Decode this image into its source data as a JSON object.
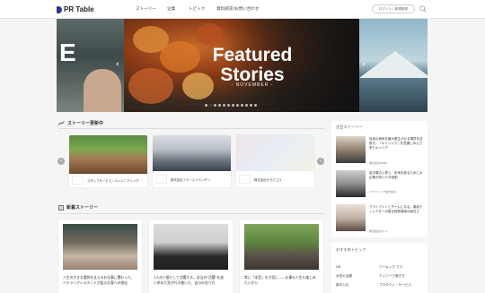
{
  "header": {
    "logo_text": "PR Table",
    "nav": [
      "ストーリー",
      "企業",
      "トピック",
      "資料請求/お問い合わせ"
    ],
    "login_label": "ログイン / 新規登録",
    "brand_color": "#2b3b8c"
  },
  "hero": {
    "left_letter": "E",
    "title": "Featured Stories",
    "subtitle": "- NOVEMBER -",
    "prev_label": "‹",
    "next_label": "›",
    "slide_count": 12,
    "active_index": 1
  },
  "story_updates": {
    "heading": "ストーリー更新中",
    "companies": [
      "スタッフサービス・エンジニアリング",
      "株式会社ファーストペンギン",
      "株式会社ガラパゴス"
    ]
  },
  "new_stories": {
    "heading": "新着ストーリー",
    "items": [
      {
        "title": "人生の大きな選択を支えるお仕事に関わって。ベテランアシスタントが語るお客への想念"
      },
      {
        "title": "1人の人間として活躍する。本当の\"活躍\"を追い求めた男が行き着いた、自分の在り方"
      },
      {
        "title": "常に「本音」を大切に――仕事も人生も楽しみたいから"
      }
    ]
  },
  "sidebar": {
    "heading": "注目ストーリー",
    "items": [
      {
        "text": "自身の病気を最大限生かせる環境を目指す。「キャリング」を意識し歩んで来たキャリア",
        "company": "株式会社DMM"
      },
      {
        "text": "若手層の上昇と、未来を創るために大企業が持つべき役割",
        "company": "パナソニック株式会社"
      },
      {
        "text": "クライアントとチームになる。運用ディレクターが語る役割領域の面白さ",
        "company": "株式会社オルト"
      }
    ]
  },
  "topics": {
    "heading": "おすすめトピック",
    "items": [
      "HR",
      "ワーキング ママ",
      "女性の活躍",
      "テレワーク働き方",
      "新卒入社",
      "プロダクト・サービス"
    ]
  }
}
